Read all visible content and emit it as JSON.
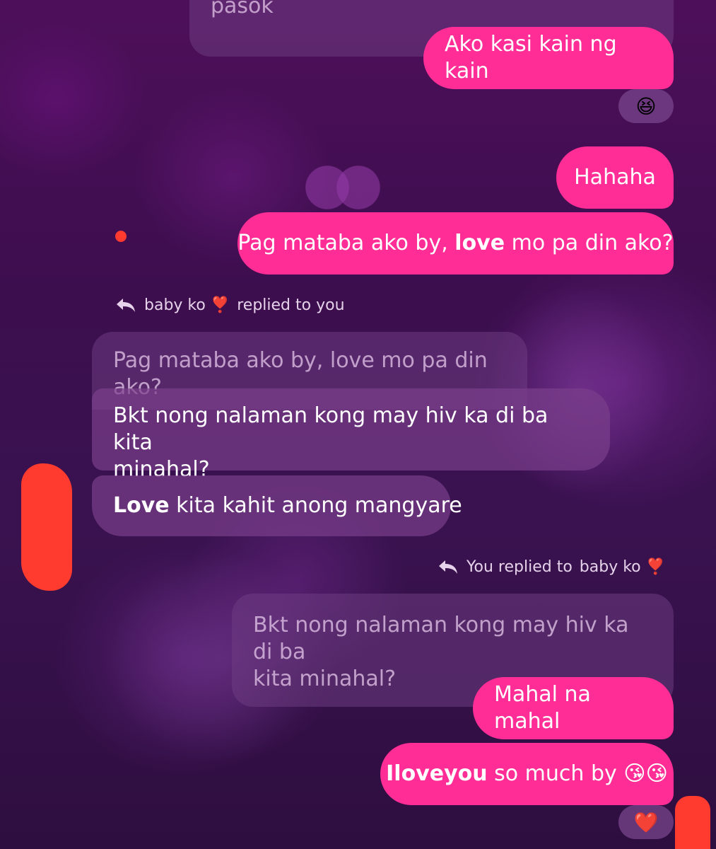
{
  "messages": {
    "m0_fragment": "pasok",
    "m1": "Ako kasi kain ng kain",
    "m1_reaction": "😆",
    "m2": "Hahaha",
    "m3_pre": "Pag mataba ako by, ",
    "m3_bold": "love",
    "m3_post": " mo pa din ako?",
    "reply1_name": "baby ko ❣️",
    "reply1_suffix": "replied to you",
    "reply1_quote": "Pag mataba ako by, love mo pa din ako?",
    "m4_line1": "Bkt nong nalaman kong may hiv ka di ba kita",
    "m4_line2": "minahal?",
    "m5_bold": "Love",
    "m5_post": " kita kahit anong mangyare",
    "reply2_prefix": "You replied to",
    "reply2_name": "baby ko ❣️",
    "reply2_quote_line1": "Bkt nong nalaman kong may hiv ka di ba",
    "reply2_quote_line2": "kita minahal?",
    "m6": "Mahal na mahal",
    "m7_bold": "Iloveyou",
    "m7_post": " so much by 😘😘",
    "m7_reaction": "❤️"
  },
  "colors": {
    "outgoing_bubble": "#ff2d95",
    "incoming_bubble": "#7a3e8c",
    "redaction": "#ff3b30"
  }
}
